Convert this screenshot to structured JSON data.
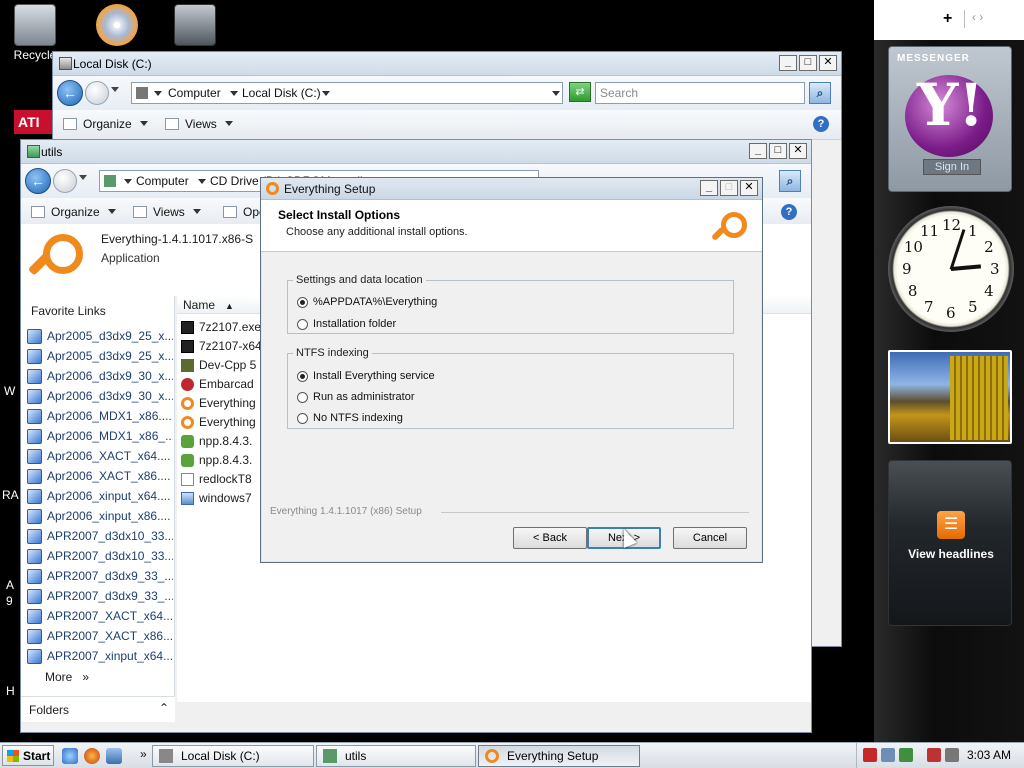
{
  "desktop": {
    "icons": [
      {
        "label": "Recycle"
      }
    ],
    "edge_texts": [
      "W",
      "RA",
      "A",
      "9",
      "H"
    ]
  },
  "local_disk_window": {
    "title": "Local Disk (C:)",
    "address": {
      "crumb1": "Computer",
      "crumb2": "Local Disk (C:)"
    },
    "search_placeholder": "Search",
    "toolbar": {
      "organize": "Organize",
      "views": "Views"
    }
  },
  "utils_window": {
    "title": "utils",
    "address": {
      "crumb1": "Computer",
      "crumb2": "CD Drive (D:) CDROM ... utils"
    },
    "toolbar": {
      "organize": "Organize",
      "views": "Views",
      "open": "Ope"
    },
    "preview": {
      "name": "Everything-1.4.1.1017.x86-S",
      "type": "Application"
    },
    "favorite_links": {
      "title": "Favorite Links",
      "items": [
        "Apr2005_d3dx9_25_x...",
        "Apr2005_d3dx9_25_x...",
        "Apr2006_d3dx9_30_x...",
        "Apr2006_d3dx9_30_x...",
        "Apr2006_MDX1_x86....",
        "Apr2006_MDX1_x86_...",
        "Apr2006_XACT_x64....",
        "Apr2006_XACT_x86....",
        "Apr2006_xinput_x64....",
        "Apr2006_xinput_x86....",
        "APR2007_d3dx10_33....",
        "APR2007_d3dx10_33....",
        "APR2007_d3dx9_33_...",
        "APR2007_d3dx9_33_...",
        "APR2007_XACT_x64....",
        "APR2007_XACT_x86....",
        "APR2007_xinput_x64...."
      ],
      "more": "More",
      "folders": "Folders"
    },
    "file_list": {
      "column_name": "Name",
      "items": [
        "7z2107.exe",
        "7z2107-x64",
        "Dev-Cpp 5",
        "Embarcad",
        "Everything",
        "Everything",
        "npp.8.4.3.",
        "npp.8.4.3.",
        "redlockT8",
        "windows7"
      ]
    }
  },
  "dialog": {
    "title": "Everything Setup",
    "heading": "Select Install Options",
    "subheading": "Choose any additional install options.",
    "group1": {
      "legend": "Settings and data location",
      "options": [
        "%APPDATA%\\Everything",
        "Installation folder"
      ],
      "selected": 0
    },
    "group2": {
      "legend": "NTFS indexing",
      "options": [
        "Install Everything service",
        "Run as administrator",
        "No NTFS indexing"
      ],
      "selected": 0
    },
    "footer": "Everything 1.4.1.1017 (x86) Setup",
    "buttons": {
      "back": "< Back",
      "next": "Next >",
      "cancel": "Cancel"
    }
  },
  "sidebar": {
    "messenger_title": "MESSENGER",
    "sign_in": "Sign In",
    "clock_numbers": [
      "12",
      "1",
      "2",
      "3",
      "4",
      "5",
      "6",
      "7",
      "8",
      "9",
      "10",
      "11"
    ],
    "feed_label": "View headlines"
  },
  "taskbar": {
    "start": "Start",
    "tasks": [
      "Local Disk (C:)",
      "utils",
      "Everything Setup"
    ],
    "time": "3:03 AM"
  }
}
